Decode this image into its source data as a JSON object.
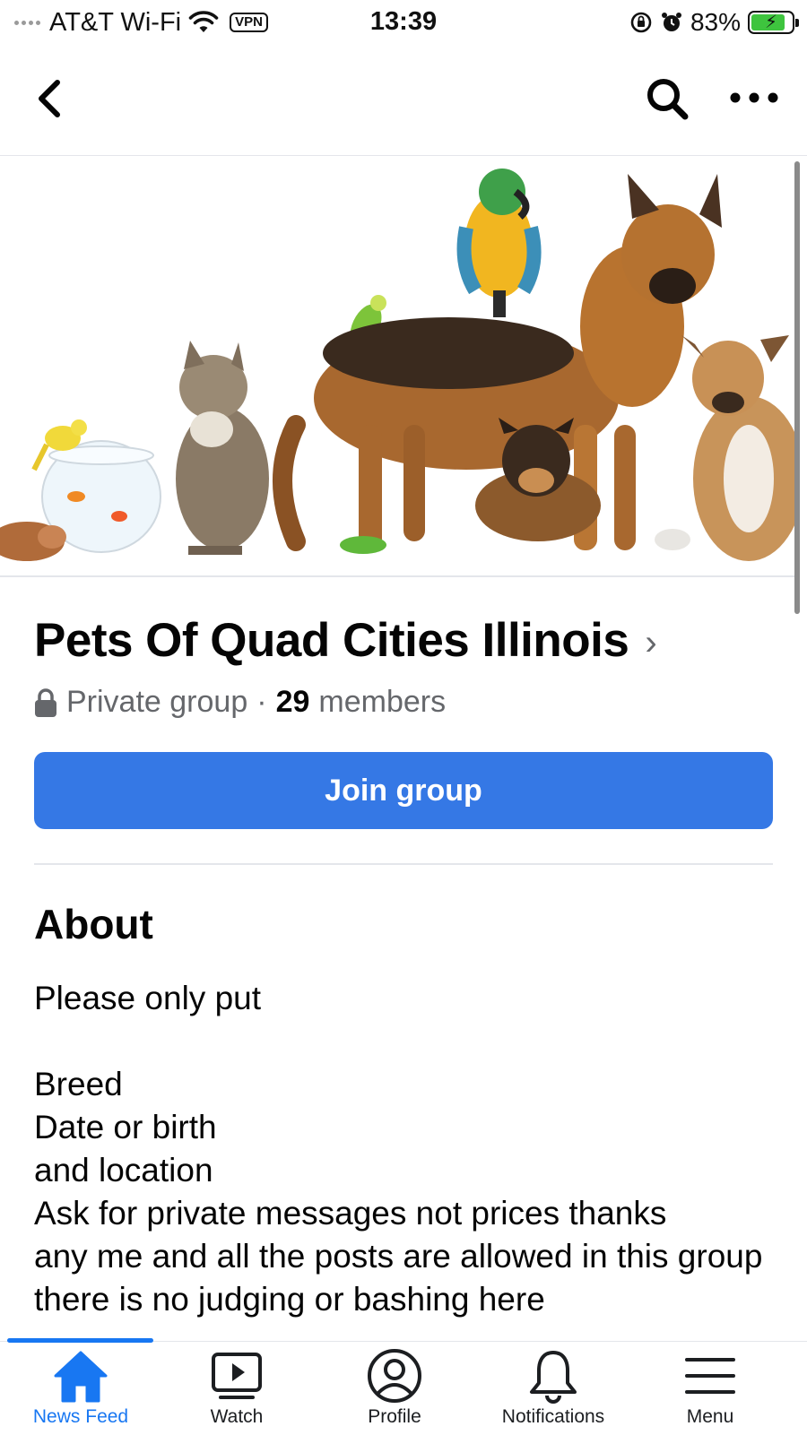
{
  "status_bar": {
    "carrier": "AT&T Wi-Fi",
    "vpn_label": "VPN",
    "time": "13:39",
    "battery_percent_label": "83%",
    "battery_level": 0.83
  },
  "group": {
    "title": "Pets Of Quad Cities Illinois",
    "title_chevron": "›",
    "privacy": "Private group",
    "separator": "·",
    "member_count": "29",
    "members_label": "members",
    "join_label": "Join group"
  },
  "about": {
    "heading": "About",
    "body": "Please only put\n\nBreed\nDate or birth\nand location\nAsk for private messages not prices thanks\nany me and all the posts are allowed in this group\nthere is no judging or bashing here"
  },
  "tabs": [
    {
      "label": "News Feed",
      "icon": "home-icon",
      "active": true
    },
    {
      "label": "Watch",
      "icon": "video-play-icon",
      "active": false
    },
    {
      "label": "Profile",
      "icon": "profile-icon",
      "active": false
    },
    {
      "label": "Notifications",
      "icon": "bell-icon",
      "active": false
    },
    {
      "label": "Menu",
      "icon": "hamburger-menu-icon",
      "active": false
    }
  ],
  "colors": {
    "accent": "#1877f2",
    "join_button": "#3578e5",
    "battery_fill": "#3ec43e",
    "secondary_text": "#65676b"
  }
}
